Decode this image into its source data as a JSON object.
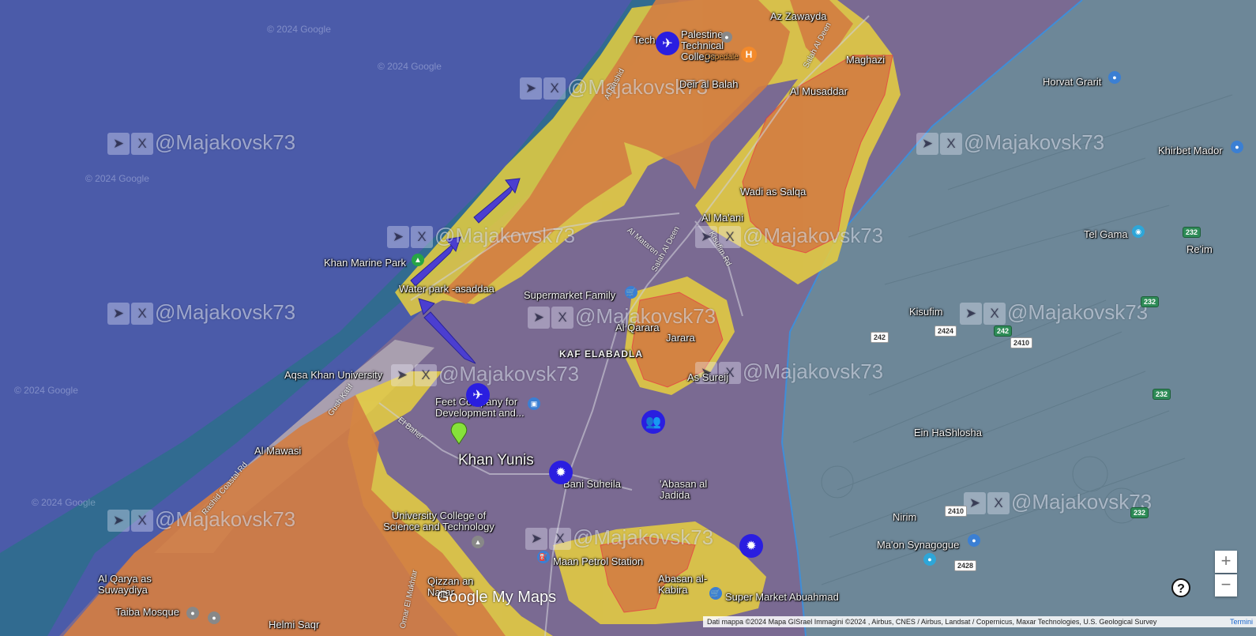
{
  "map": {
    "places": {
      "palestine_college": "Palestine Technical College",
      "tech_prefix": "Tech",
      "az_zawayda": "Az Zawayda",
      "ospedale": "Ospedale",
      "maghazi": "Maghazi",
      "deir_al_balah": "Deir al Balah",
      "al_musaddar": "Al Musaddar",
      "horvat_grarit": "Horvat Grarit",
      "khirbet_mador": "Khirbet Mador",
      "wadi_as_salqa": "Wadi as Salqa",
      "al_maani": "Al Ma'ani",
      "tel_gama": "Tel Gama",
      "re_im": "Re'im",
      "khan_marine_park": "Khan Marine Park",
      "water_park": "Water park -asaddaa",
      "supermarket_family": "Supermarket Family",
      "kisufim": "Kisufim",
      "al_qarara": "Al Qarara",
      "jarara": "Jarara",
      "kaf_elabadla": "KAF ELABADLA",
      "as_sureij": "As Sureij",
      "aqsa_khan_university": "Aqsa Khan University",
      "feet_company": "Feet Company for Development and...",
      "ein_hashlosha": "Ein HaShlosha",
      "al_mawasi": "Al Mawasi",
      "khan_yunis": "Khan Yunis",
      "bani_suheila": "Bani Suheila",
      "abasan_al_jadida": "'Abasan al Jadida",
      "university_college": "University College of Science and Technology",
      "nirim": "Nirim",
      "maon_synagogue": "Ma'on Synagogue",
      "al_qarya": "Al Qarya as Suwaydiya",
      "qizzan": "Qizzan an Najjar",
      "maan_petrol": "Maan Petrol Station",
      "abasan_al_kabira": "Abasan al-Kabira",
      "super_market_abuahmad": "Super Market Abuahmad",
      "taiba_mosque": "Taiba Mosque",
      "helmi_saqr": "Helmi Saqr"
    },
    "roads": {
      "al_rashid": "Al Rashid",
      "salah_al_deen": "Salah Al Deen",
      "al_mataren": "Al Mataren",
      "kisufim_rd": "Kisufim Rd",
      "el_baher": "El Baher",
      "gush_katif": "Gush Katif",
      "rashid_coastal": "Rashid Coastal Rd",
      "salah_al_deen_2": "Salah Al Deen",
      "omar_el_mukhtar": "Omar El Mukhtar"
    },
    "route_shields": [
      "232",
      "242",
      "2424",
      "2410",
      "242",
      "232",
      "2410",
      "232",
      "2428",
      "232"
    ],
    "watermark_handle": "@Majakovsk73",
    "copyright": "© 2024 Google",
    "logo_text": "Google My Maps",
    "attribution": "Dati mappa ©2024 Mapa GISrael Immagini ©2024 , Airbus, CNES / Airbus, Landsat / Copernicus, Maxar Technologies, U.S. Geological Survey",
    "terms": "Termini",
    "zoom_in": "+",
    "zoom_out": "−",
    "help": "?"
  },
  "colors": {
    "sea": "#4a5aa8",
    "coast_water": "#2f7b8a",
    "orange_zone": "#d07f45",
    "yellow_zone": "#e8cf3e",
    "purple_urban": "#7a6a95",
    "israel_land": "#6f8aa0",
    "marker_blue": "#2a1ee0",
    "arrow": "#3a34b8"
  },
  "icons": [
    "telegram-icon",
    "x-icon",
    "drone-icon",
    "hospital-icon",
    "explosion-icon",
    "people-icon",
    "location-pin-icon",
    "park-icon"
  ]
}
